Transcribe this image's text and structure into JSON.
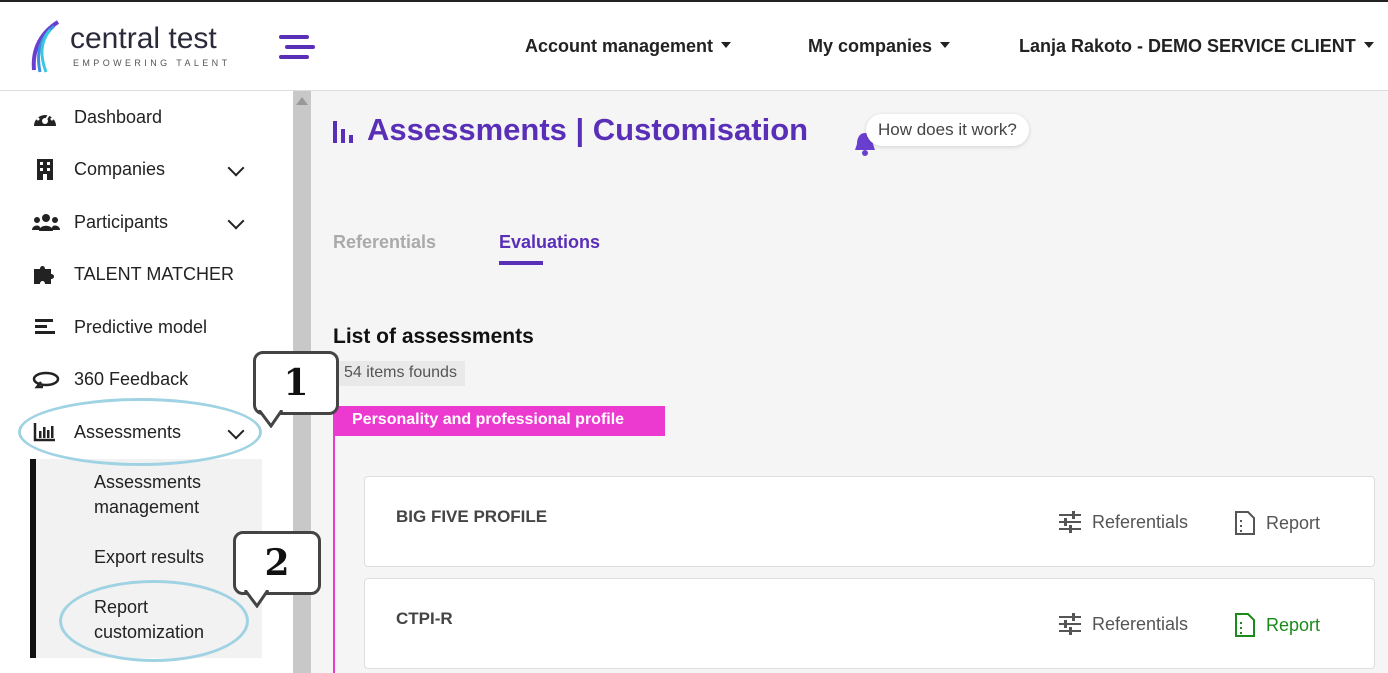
{
  "header": {
    "logo_name": "central test",
    "logo_tagline": "EMPOWERING TALENT",
    "menu_icon": "hamburger-icon",
    "nav": [
      {
        "label": "Account management"
      },
      {
        "label": "My companies"
      },
      {
        "label": "Lanja Rakoto - DEMO SERVICE CLIENT"
      }
    ]
  },
  "sidebar": {
    "items": [
      {
        "label": "Dashboard",
        "icon": "dashboard-icon"
      },
      {
        "label": "Companies",
        "icon": "building-icon"
      },
      {
        "label": "Participants",
        "icon": "users-icon"
      },
      {
        "label": "TALENT MATCHER",
        "icon": "puzzle-icon"
      },
      {
        "label": "Predictive model",
        "icon": "bars-icon"
      },
      {
        "label": "360 Feedback",
        "icon": "rotate-icon"
      },
      {
        "label": "Assessments",
        "icon": "chart-icon"
      }
    ],
    "submenu": [
      {
        "label": "Assessments management"
      },
      {
        "label": "Export results"
      },
      {
        "label": "Report customization"
      }
    ]
  },
  "main": {
    "title": "Assessments | Customisation",
    "help_label": "How does it work?",
    "tabs": [
      {
        "label": "Referentials",
        "active": false
      },
      {
        "label": "Evaluations",
        "active": true
      }
    ],
    "list_title": "List of assessments",
    "count_label": "54 items founds",
    "category": "Personality and professional profile",
    "assessments": [
      {
        "name": "BIG FIVE PROFILE",
        "referentials_label": "Referentials",
        "report_label": "Report",
        "report_active": false
      },
      {
        "name": "CTPI-R",
        "referentials_label": "Referentials",
        "report_label": "Report",
        "report_active": true
      }
    ]
  },
  "annotations": {
    "callout_1": "1",
    "callout_2": "2"
  },
  "colors": {
    "accent": "#5a2fb8",
    "category": "#ec3ad0",
    "report_active": "#1a8a1a",
    "highlight": "#9fd3e3"
  }
}
